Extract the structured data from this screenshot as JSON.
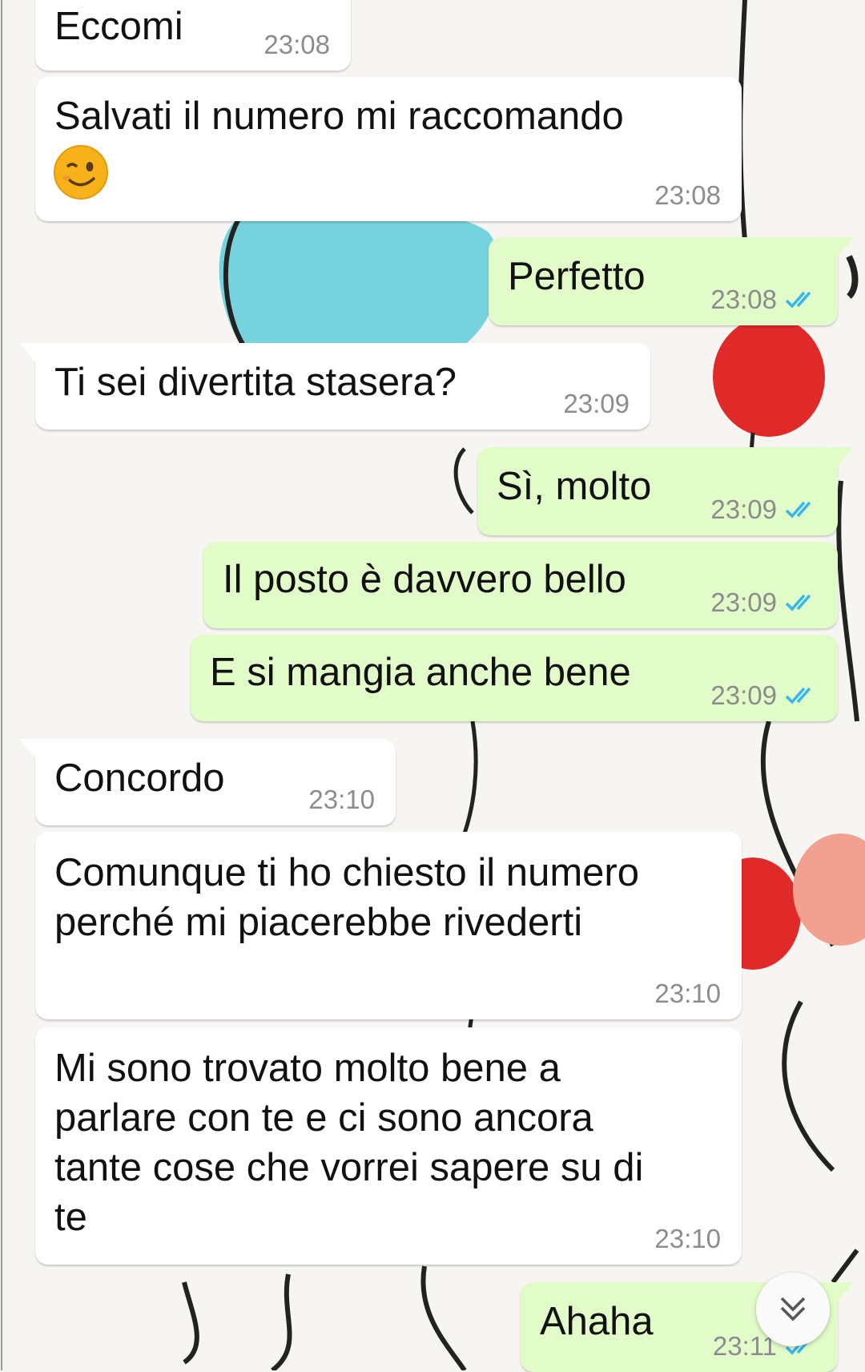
{
  "theme": {
    "incoming_bg": "#ffffff",
    "outgoing_bg": "#e2fcc9",
    "time_color": "#8c8c8c",
    "tick_color": "#34b7f1"
  },
  "messages": [
    {
      "id": "m1",
      "direction": "incoming",
      "text": "Eccomi",
      "time": "23:08"
    },
    {
      "id": "m2",
      "direction": "incoming",
      "lines": [
        "Salvati il numero mi raccomando"
      ],
      "emoji": "winking-face-emoji",
      "time": "23:08"
    },
    {
      "id": "m3",
      "direction": "outgoing",
      "text": "Perfetto",
      "time": "23:08",
      "status": "read"
    },
    {
      "id": "m4",
      "direction": "incoming",
      "text": "Ti sei divertita stasera?",
      "time": "23:09"
    },
    {
      "id": "m5",
      "direction": "outgoing",
      "text": "Sì, molto",
      "time": "23:09",
      "status": "read"
    },
    {
      "id": "m6",
      "direction": "outgoing",
      "text": "Il posto è davvero bello",
      "time": "23:09",
      "status": "read"
    },
    {
      "id": "m7",
      "direction": "outgoing",
      "text": "E si mangia anche bene",
      "time": "23:09",
      "status": "read"
    },
    {
      "id": "m8",
      "direction": "incoming",
      "text": "Concordo",
      "time": "23:10"
    },
    {
      "id": "m9",
      "direction": "incoming",
      "lines": [
        "Comunque ti ho chiesto il numero",
        "perché mi piacerebbe rivederti"
      ],
      "time": "23:10"
    },
    {
      "id": "m10",
      "direction": "incoming",
      "lines": [
        "Mi sono trovato molto bene a",
        "parlare con te e ci sono ancora",
        "tante cose che vorrei sapere su di",
        "te"
      ],
      "time": "23:10"
    },
    {
      "id": "m11",
      "direction": "outgoing",
      "text": "Ahaha",
      "time": "23:11",
      "status": "read"
    }
  ],
  "scroll_button": {
    "icon": "double-chevron-down-icon"
  }
}
